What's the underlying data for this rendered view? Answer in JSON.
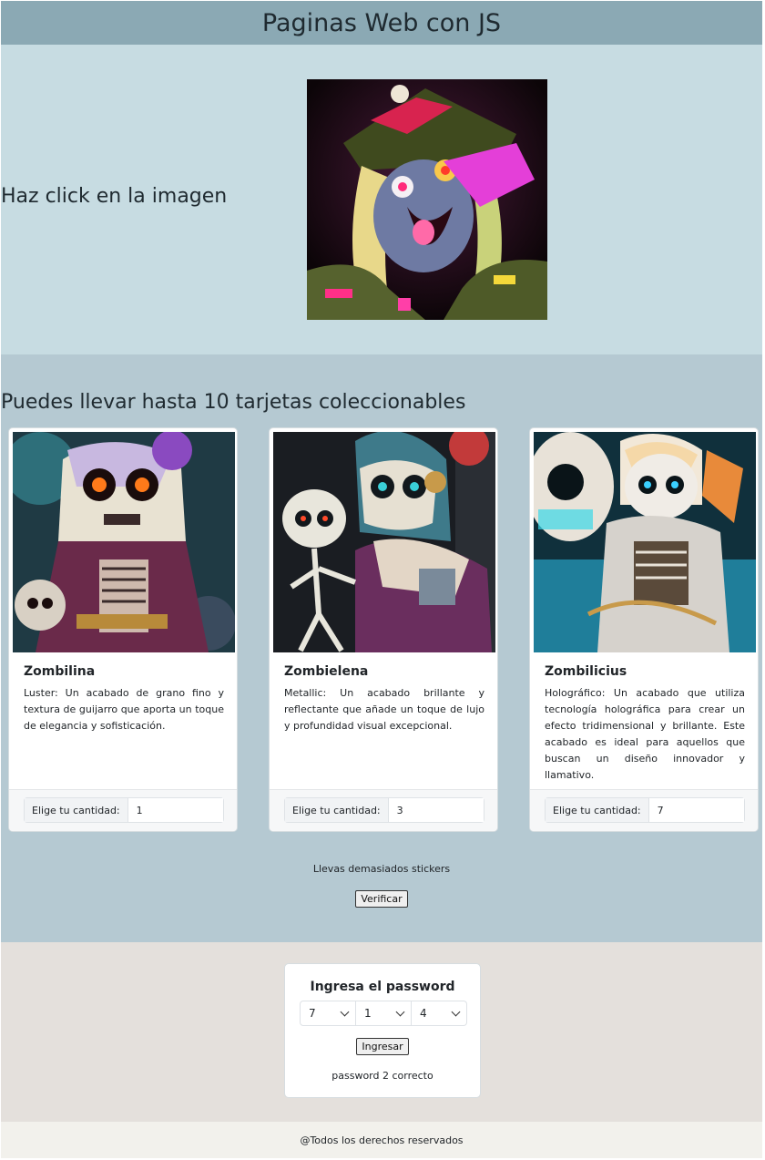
{
  "header": {
    "title": "Paginas Web con JS"
  },
  "hero": {
    "text": "Haz click en la imagen",
    "image_icon": "punk-zombie-girl-illustration"
  },
  "cards_section": {
    "heading": "Puedes llevar hasta 10 tarjetas coleccionables",
    "cards": [
      {
        "title": "Zombilina",
        "description": "Luster: Un acabado de grano fino y textura de guijarro que aporta un toque de elegancia y sofisticación.",
        "quantity_label": "Elige tu cantidad:",
        "quantity": "1",
        "image_icon": "skeleton-girl-card-image"
      },
      {
        "title": "Zombielena",
        "description": "Metallic: Un acabado brillante y reflectante que añade un toque de lujo y profundidad visual excepcional.",
        "quantity_label": "Elige tu cantidad:",
        "quantity": "3",
        "image_icon": "skeleton-pair-card-image"
      },
      {
        "title": "Zombilicius",
        "description": "Holográfico: Un acabado que utiliza tecnología holográfica para crear un efecto tridimensional y brillante. Este acabado es ideal para aquellos que buscan un diseño innovador y llamativo.",
        "quantity_label": "Elige tu cantidad:",
        "quantity": "7",
        "image_icon": "skull-child-card-image"
      }
    ],
    "status_message": "Llevas demasiados stickers",
    "verify_label": "Verificar"
  },
  "password": {
    "title": "Ingresa el password",
    "selects": [
      "7",
      "1",
      "4"
    ],
    "submit_label": "Ingresar",
    "status": "password 2 correcto"
  },
  "footer": {
    "text": "@Todos los derechos reservados"
  },
  "colors": {
    "header_bg": "#8ba9b4",
    "hero_bg": "#c7dce2",
    "cards_bg": "#b5c9d2",
    "password_bg": "#e4e0dc",
    "footer_bg": "#f2f1ec"
  }
}
